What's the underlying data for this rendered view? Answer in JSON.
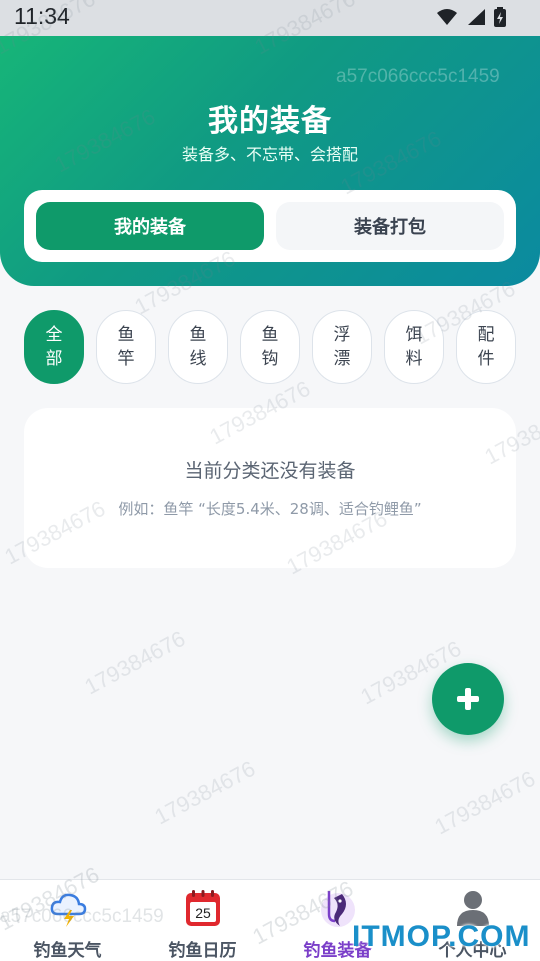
{
  "status_bar": {
    "time": "11:34"
  },
  "header": {
    "title": "我的装备",
    "subtitle": "装备多、不忘带、会搭配",
    "toggle": {
      "my_gear": "我的装备",
      "pack": "装备打包"
    }
  },
  "categories": [
    "全\n部",
    "鱼\n竿",
    "鱼\n线",
    "鱼\n钩",
    "浮\n漂",
    "饵\n料",
    "配\n件"
  ],
  "selected_category": "全部",
  "empty_state": {
    "title": "当前分类还没有装备",
    "example": "例如：鱼竿 “长度5.4米、28调、适合钓鲤鱼”"
  },
  "fab": {
    "icon": "plus-icon"
  },
  "bottom_nav": [
    {
      "label": "钓鱼天气",
      "icon": "weather-icon"
    },
    {
      "label": "钓鱼日历",
      "icon": "calendar-icon",
      "day": "25"
    },
    {
      "label": "钓鱼装备",
      "icon": "fishing-gear-icon",
      "active": true
    },
    {
      "label": "个人中心",
      "icon": "profile-icon"
    }
  ],
  "watermark": {
    "text": "179384676",
    "hash": "a57c066ccc5c1459"
  },
  "brand_overlay": "ITMOP.COM",
  "colors": {
    "primary": "#0f9a6a",
    "nav_active": "#7b3fc9",
    "gradient_start": "#17b877",
    "gradient_end": "#0b8aa0"
  }
}
